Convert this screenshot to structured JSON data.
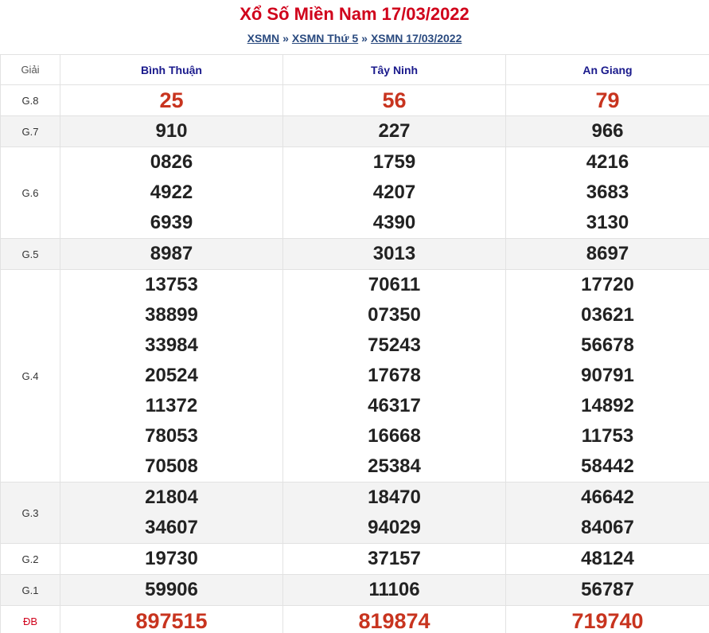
{
  "header": {
    "title": "Xổ Số Miền Nam 17/03/2022",
    "breadcrumb": [
      "XSMN",
      "XSMN Thứ 5",
      "XSMN 17/03/2022"
    ],
    "separator": "»"
  },
  "table": {
    "label_header": "Giải",
    "provinces": [
      "Bình Thuận",
      "Tây Ninh",
      "An Giang"
    ],
    "rows": [
      {
        "label": "G.8",
        "values": [
          [
            "25"
          ],
          [
            "56"
          ],
          [
            "79"
          ]
        ]
      },
      {
        "label": "G.7",
        "values": [
          [
            "910"
          ],
          [
            "227"
          ],
          [
            "966"
          ]
        ]
      },
      {
        "label": "G.6",
        "values": [
          [
            "0826",
            "4922",
            "6939"
          ],
          [
            "1759",
            "4207",
            "4390"
          ],
          [
            "4216",
            "3683",
            "3130"
          ]
        ]
      },
      {
        "label": "G.5",
        "values": [
          [
            "8987"
          ],
          [
            "3013"
          ],
          [
            "8697"
          ]
        ]
      },
      {
        "label": "G.4",
        "values": [
          [
            "13753",
            "38899",
            "33984",
            "20524",
            "11372",
            "78053",
            "70508"
          ],
          [
            "70611",
            "07350",
            "75243",
            "17678",
            "46317",
            "16668",
            "25384"
          ],
          [
            "17720",
            "03621",
            "56678",
            "90791",
            "14892",
            "11753",
            "58442"
          ]
        ]
      },
      {
        "label": "G.3",
        "values": [
          [
            "21804",
            "34607"
          ],
          [
            "18470",
            "94029"
          ],
          [
            "46642",
            "84067"
          ]
        ]
      },
      {
        "label": "G.2",
        "values": [
          [
            "19730"
          ],
          [
            "37157"
          ],
          [
            "48124"
          ]
        ]
      },
      {
        "label": "G.1",
        "values": [
          [
            "59906"
          ],
          [
            "11106"
          ],
          [
            "56787"
          ]
        ]
      },
      {
        "label": "ĐB",
        "values": [
          [
            "897515"
          ],
          [
            "819874"
          ],
          [
            "719740"
          ]
        ]
      }
    ]
  },
  "colors": {
    "title": "#d0021b",
    "province_header": "#1a1a8c",
    "highlight_numbers": "#c8341f",
    "alt_row_bg": "#f3f3f3"
  }
}
